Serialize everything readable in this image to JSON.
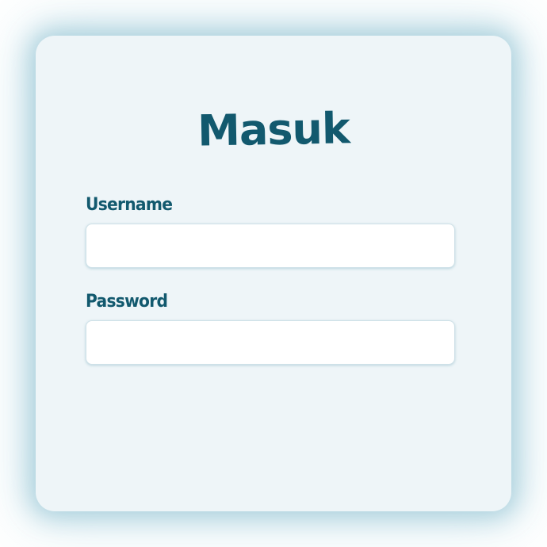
{
  "login": {
    "title": "Masuk",
    "username": {
      "label": "Username",
      "value": ""
    },
    "password": {
      "label": "Password",
      "value": ""
    }
  },
  "colors": {
    "accent": "#12596e",
    "card_background": "#eef5f8",
    "glow": "#96c4d4",
    "input_background": "#ffffff"
  }
}
